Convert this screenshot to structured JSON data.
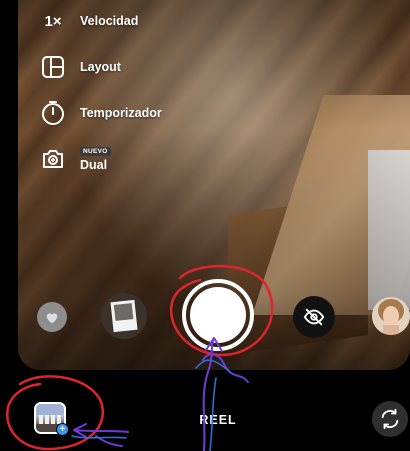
{
  "menu": {
    "speed": {
      "glyph": "1×",
      "label": "Velocidad",
      "icon": "speed-icon"
    },
    "layout": {
      "label": "Layout",
      "icon": "layout-icon"
    },
    "timer": {
      "label": "Temporizador",
      "icon": "timer-icon"
    },
    "dual": {
      "badge": "NUEVO",
      "label": "Dual",
      "icon": "dual-camera-icon"
    }
  },
  "capture_row": {
    "left_effect": "heart-effect-icon",
    "photo_effect": "photo-effect-thumbnail",
    "shutter": "record-button",
    "hide_effect": "eye-off-icon",
    "face_effect": "face-effect-thumbnail"
  },
  "bottom_bar": {
    "mode": "REEL",
    "gallery": "gallery-icon",
    "plus": "+",
    "flip": "flip-camera-icon"
  },
  "annotations": {
    "color_red": "#e0242b",
    "color_ink": "#6f3bd6"
  }
}
